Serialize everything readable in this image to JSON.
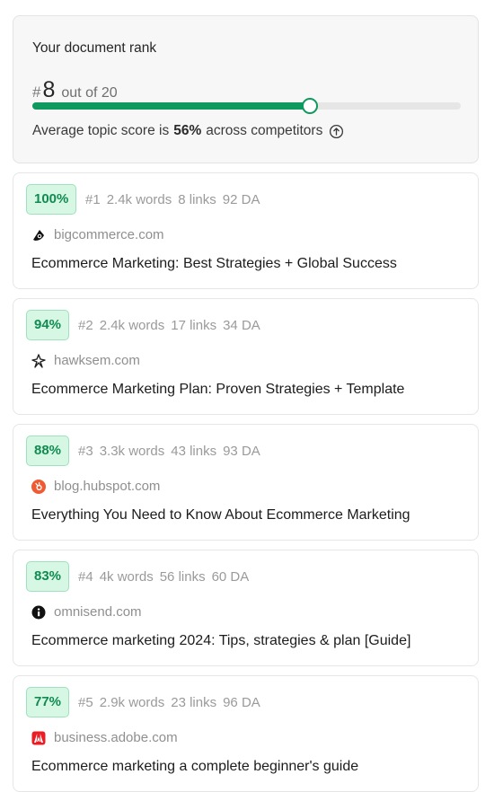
{
  "rank": {
    "title": "Your document rank",
    "hash": "#",
    "position": "8",
    "out_of": "out of 20",
    "progress_fraction": 0.662,
    "avg_prefix": "Average topic score is",
    "avg_value": "56%",
    "avg_suffix": "across competitors",
    "accent_color": "#0e9a5e"
  },
  "results": [
    {
      "score": "100%",
      "rank": "#1",
      "words": "2.4k words",
      "links": "8 links",
      "da": "92 DA",
      "domain": "bigcommerce.com",
      "favicon": "bigcommerce-icon",
      "title": "Ecommerce Marketing: Best Strategies + Global Success"
    },
    {
      "score": "94%",
      "rank": "#2",
      "words": "2.4k words",
      "links": "17 links",
      "da": "34 DA",
      "domain": "hawksem.com",
      "favicon": "hawksem-icon",
      "title": "Ecommerce Marketing Plan: Proven Strategies + Template"
    },
    {
      "score": "88%",
      "rank": "#3",
      "words": "3.3k words",
      "links": "43 links",
      "da": "93 DA",
      "domain": "blog.hubspot.com",
      "favicon": "hubspot-icon",
      "title": "Everything You Need to Know About Ecommerce Marketing"
    },
    {
      "score": "83%",
      "rank": "#4",
      "words": "4k words",
      "links": "56 links",
      "da": "60 DA",
      "domain": "omnisend.com",
      "favicon": "omnisend-icon",
      "title": "Ecommerce marketing 2024: Tips, strategies & plan [Guide]"
    },
    {
      "score": "77%",
      "rank": "#5",
      "words": "2.9k words",
      "links": "23 links",
      "da": "96 DA",
      "domain": "business.adobe.com",
      "favicon": "adobe-icon",
      "title": "Ecommerce marketing a complete beginner's guide"
    }
  ]
}
